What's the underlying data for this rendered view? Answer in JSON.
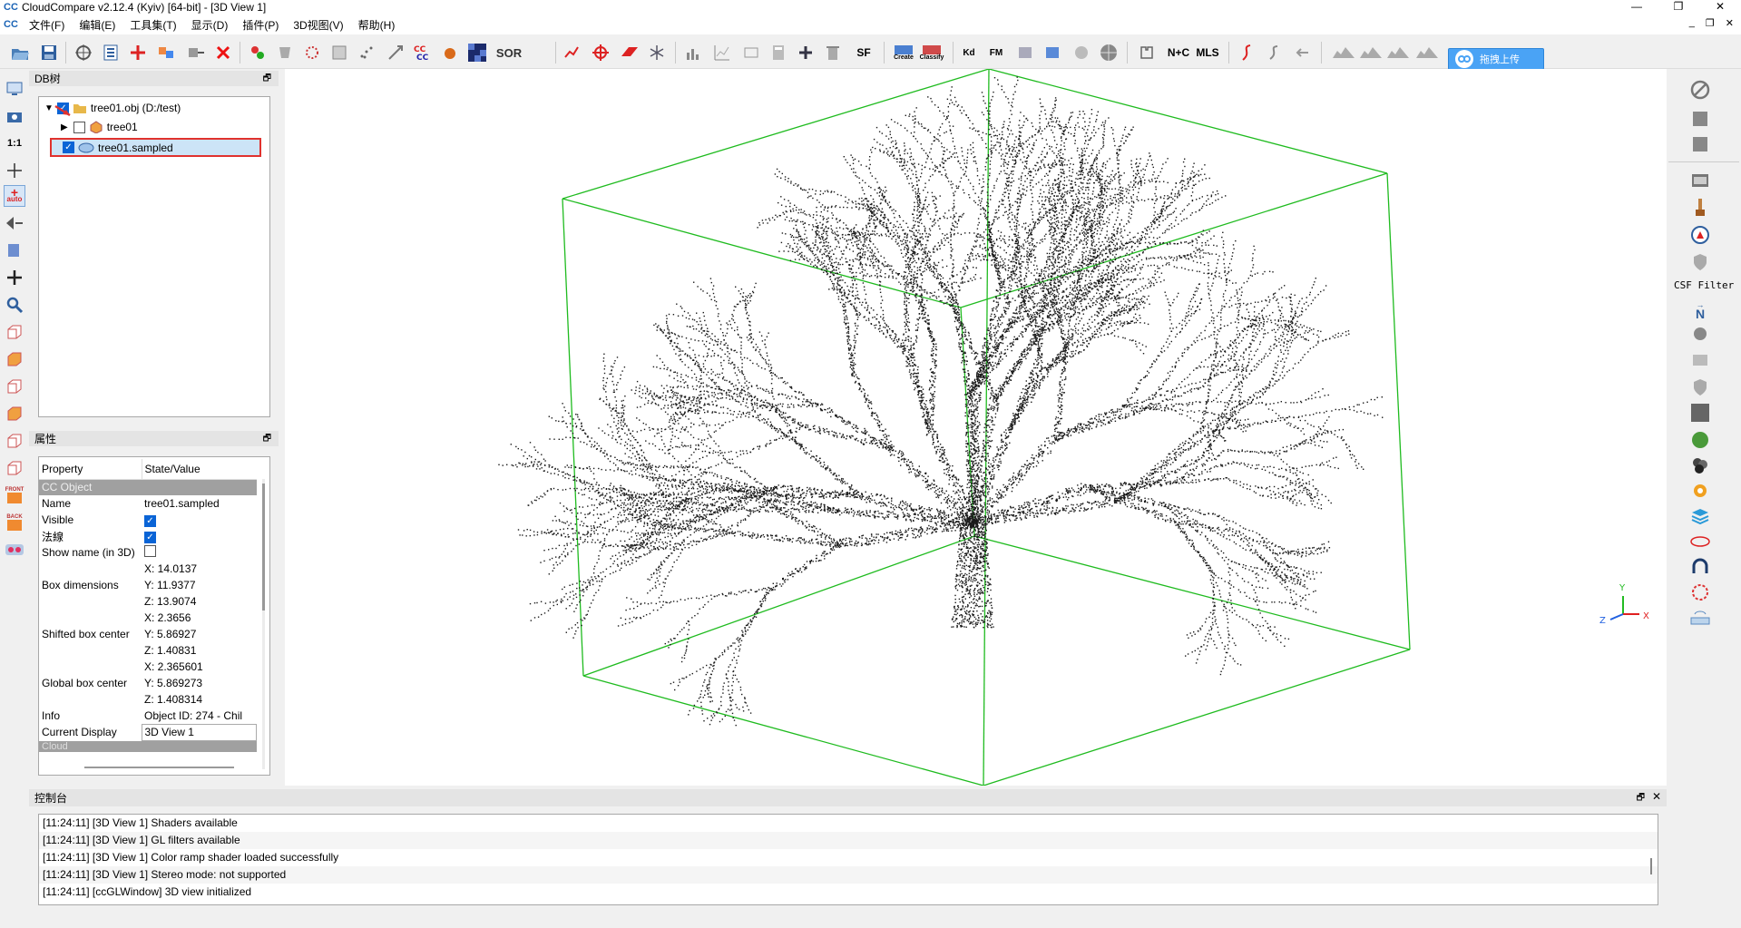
{
  "window": {
    "title": "CloudCompare v2.12.4 (Kyiv) [64-bit] - [3D View 1]",
    "app_icon": "CC"
  },
  "menu": {
    "items": [
      "文件(F)",
      "编辑(E)",
      "工具集(T)",
      "显示(D)",
      "插件(P)",
      "3D视图(V)",
      "帮助(H)"
    ]
  },
  "toolbar": {
    "text_buttons": {
      "sor": "SOR",
      "sf": "SF",
      "nc": "N+C",
      "mls": "MLS",
      "kd": "Kd",
      "fm": "FM",
      "canupo_create": "Create",
      "canupo_classify": "Classify"
    },
    "cloud_upload_label": "拖拽上传"
  },
  "leftbar": {
    "zoom_label": "1:1",
    "auto_label": "auto",
    "front_label": "FRONT",
    "back_label": "BACK"
  },
  "db_tree": {
    "header": "DB树",
    "items": [
      {
        "label": "tree01.obj (D:/test)",
        "checked": true
      },
      {
        "label": "tree01",
        "checked": false
      },
      {
        "label": "tree01.sampled",
        "checked": true,
        "selected": true
      }
    ]
  },
  "properties": {
    "header": "属性",
    "col_property": "Property",
    "col_value": "State/Value",
    "section_object": "CC Object",
    "name_label": "Name",
    "name_value": "tree01.sampled",
    "visible_label": "Visible",
    "normals_label": "法線",
    "show_name_label": "Show name (in 3D)",
    "box_dim_label": "Box dimensions",
    "box_dim_x": "X: 14.0137",
    "box_dim_y": "Y: 11.9377",
    "box_dim_z": "Z: 13.9074",
    "shifted_label": "Shifted box center",
    "shifted_x": "X: 2.3656",
    "shifted_y": "Y: 5.86927",
    "shifted_z": "Z: 1.40831",
    "global_label": "Global box center",
    "global_x": "X: 2.365601",
    "global_y": "Y: 5.869273",
    "global_z": "Z: 1.408314",
    "info_label": "Info",
    "info_value": "Object ID: 274 - Chil",
    "display_label": "Current Display",
    "display_value": "3D View 1",
    "section_cloud": "Cloud"
  },
  "rightbar": {
    "csf_label": "CSF Filter",
    "n_label": "N"
  },
  "axes": {
    "x": "X",
    "y": "Y",
    "z": "Z"
  },
  "console": {
    "header": "控制台",
    "lines": [
      "[11:24:11] [3D View 1] Shaders available",
      "[11:24:11] [3D View 1] GL filters available",
      "[11:24:11] [3D View 1] Color ramp shader loaded successfully",
      "[11:24:11] [3D View 1] Stereo mode: not supported",
      "[11:24:11] [ccGLWindow] 3D view initialized"
    ]
  },
  "colors": {
    "bbox": "#1fbb1f",
    "selection_outline": "#e0322e",
    "accent": "#0a64d6"
  }
}
